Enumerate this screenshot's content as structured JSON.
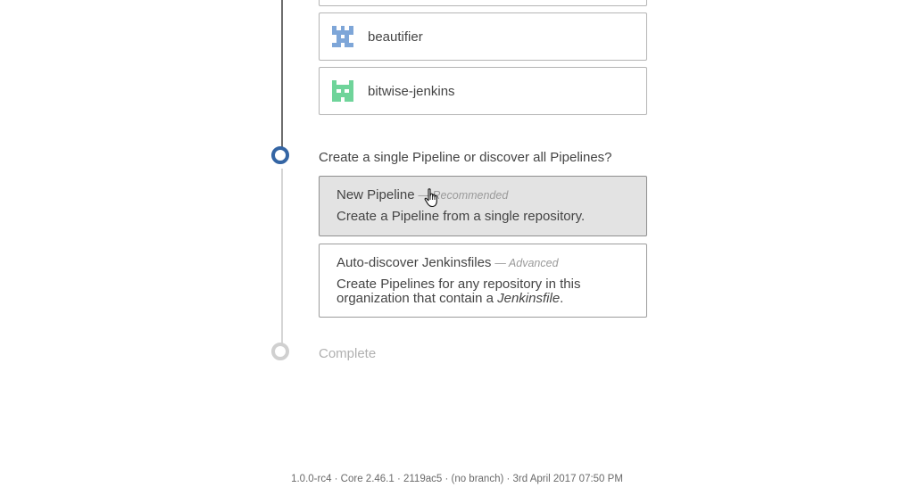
{
  "repositories": [
    {
      "name": "",
      "avatar_color": "#8fb3e0"
    },
    {
      "name": "beautifier",
      "avatar_color": "#7ea6d8"
    },
    {
      "name": "bitwise-jenkins",
      "avatar_color": "#6fd49a"
    }
  ],
  "step_pipeline": {
    "title": "Create a single Pipeline or discover all Pipelines?",
    "options": [
      {
        "label": "New Pipeline",
        "tag": "— Recommended",
        "description": "Create a Pipeline from a single repository.",
        "selected": true
      },
      {
        "label": "Auto-discover Jenkinsfiles",
        "tag": "— Advanced",
        "description_prefix": "Create Pipelines for any repository in this organization that contain a ",
        "description_em": "Jenkinsfile",
        "description_suffix": ".",
        "selected": false
      }
    ]
  },
  "step_complete": {
    "title": "Complete"
  },
  "footer": {
    "text": "1.0.0-rc4 · Core 2.46.1 · 2119ac5 · (no branch) · 3rd April 2017 07:50 PM"
  },
  "colors": {
    "active_step": "#3465a4",
    "inactive_step": "#d0d0d0",
    "selected_card": "#e3e3e3"
  }
}
